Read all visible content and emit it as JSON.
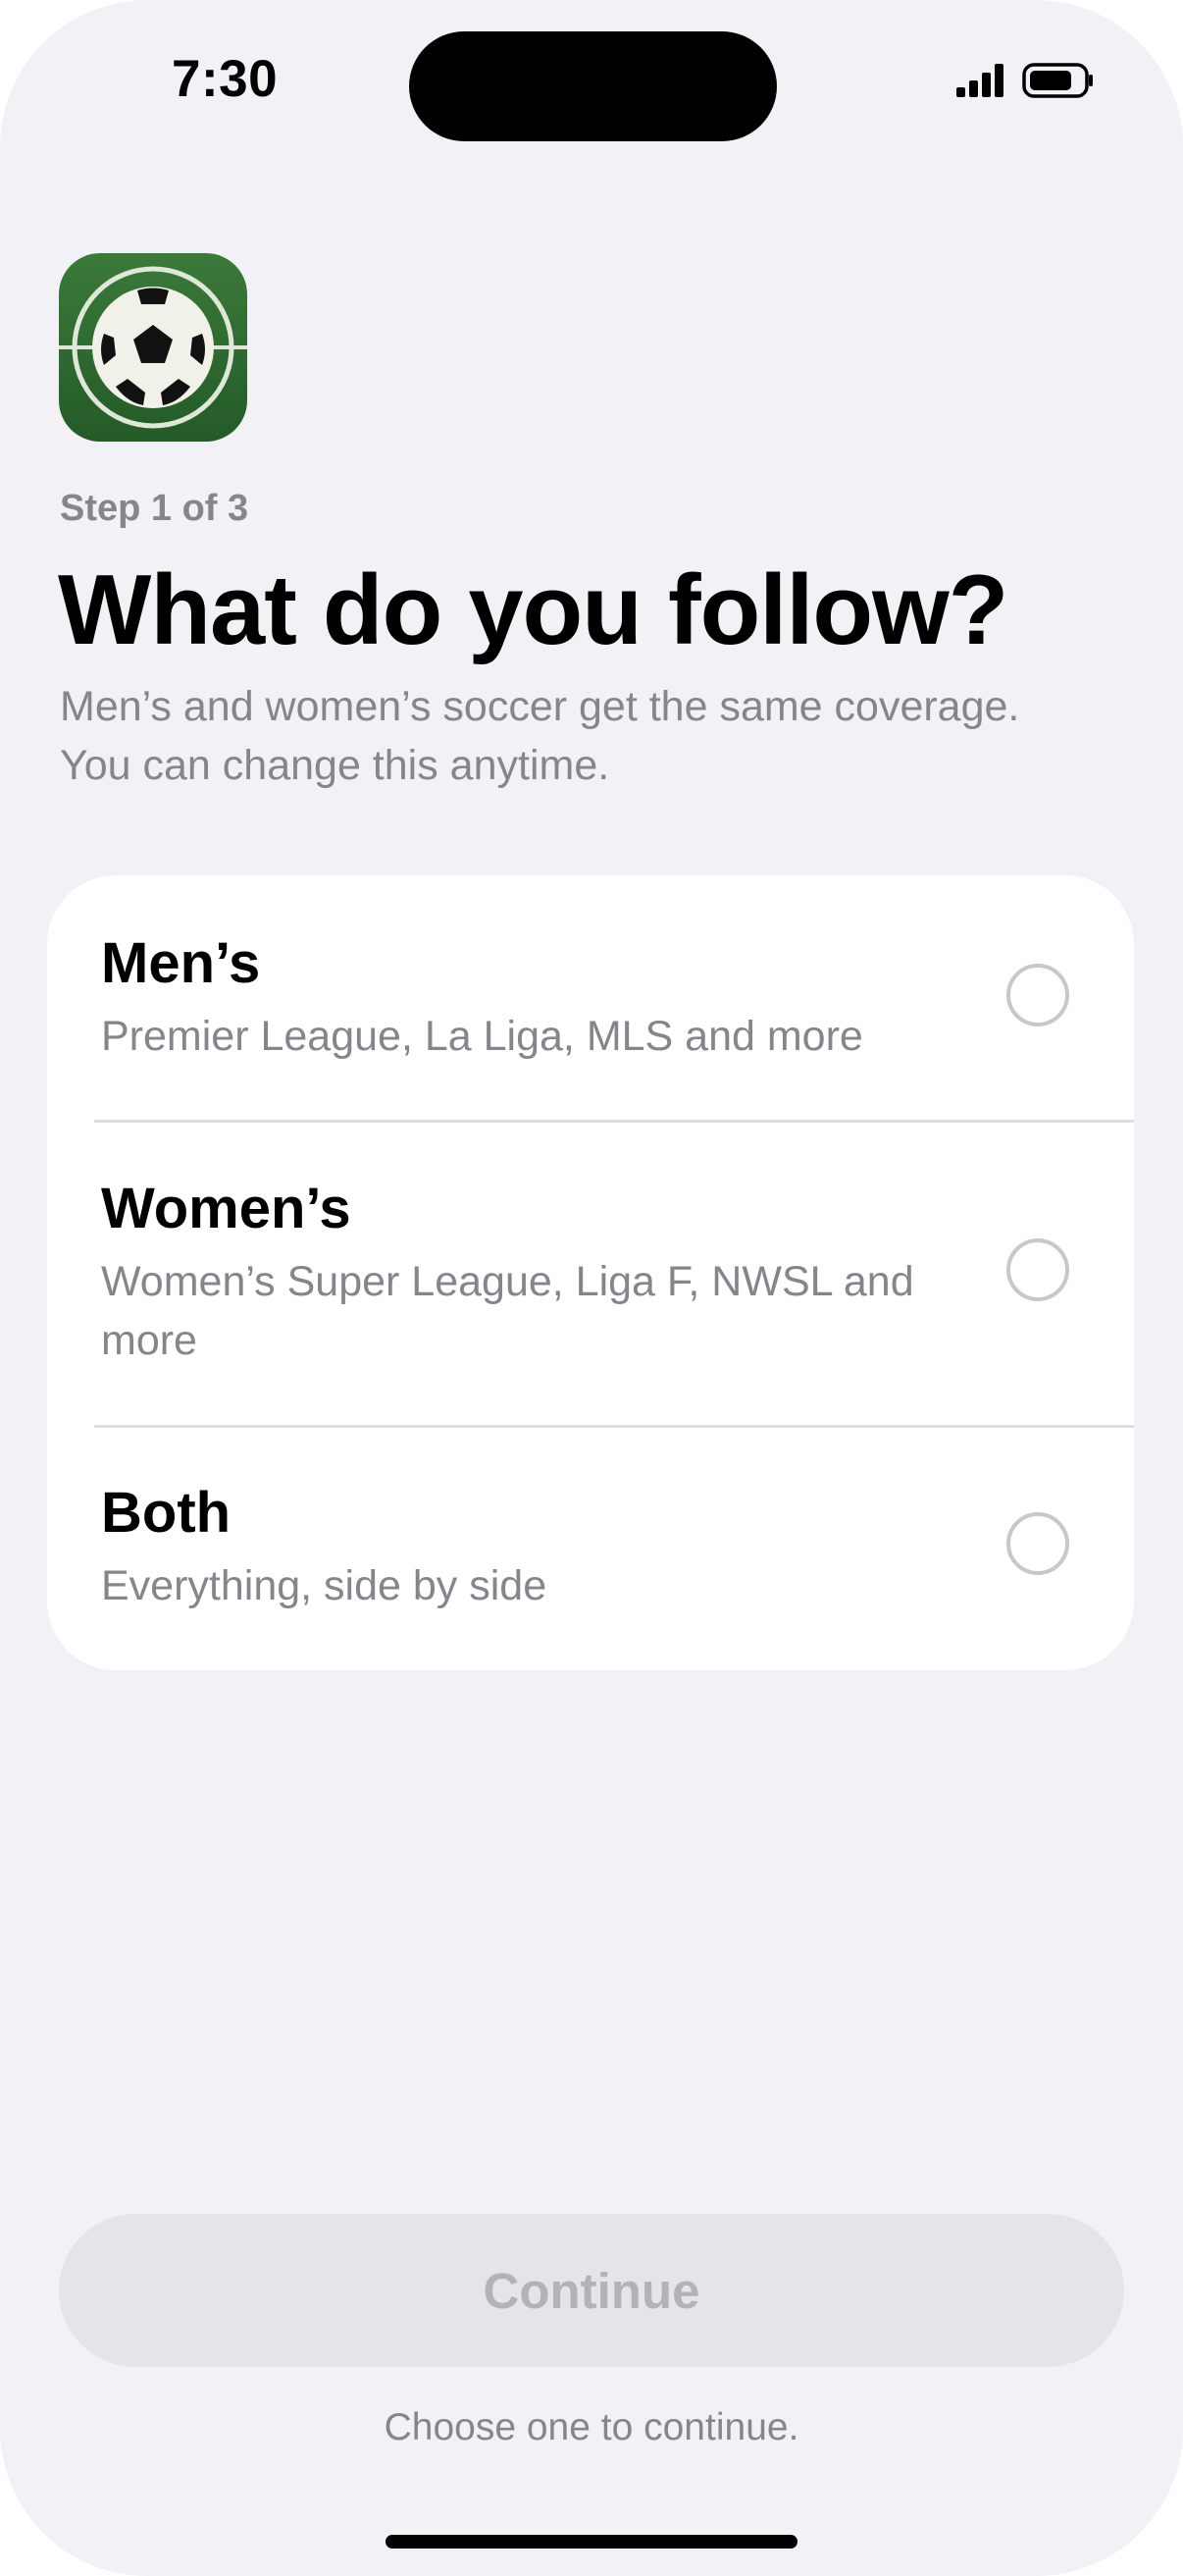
{
  "status_bar": {
    "time": "7:30",
    "signal_icon": "cellular-signal-icon",
    "battery_icon": "battery-icon"
  },
  "header": {
    "app_icon": "soccer-ball-icon",
    "step": "Step 1 of 3",
    "title": "What do you follow?",
    "subtitle_line1": "Men’s and women’s soccer get the same coverage.",
    "subtitle_line2": "You can change this anytime."
  },
  "options": [
    {
      "label": "Men’s",
      "description": "Premier League, La Liga, MLS and more",
      "selected": false
    },
    {
      "label": "Women’s",
      "description": "Women’s Super League, Liga F, NWSL and more",
      "selected": false
    },
    {
      "label": "Both",
      "description": "Everything, side by side",
      "selected": false
    }
  ],
  "footer": {
    "continue_label": "Continue",
    "continue_enabled": false,
    "hint": "Choose one to continue."
  },
  "colors": {
    "background": "#f2f1f6",
    "card": "#ffffff",
    "secondary_text": "#85858c",
    "button_disabled_bg": "#e4e4e9",
    "button_disabled_text": "#b2b2b7",
    "icon_green": "#2f6d31"
  }
}
